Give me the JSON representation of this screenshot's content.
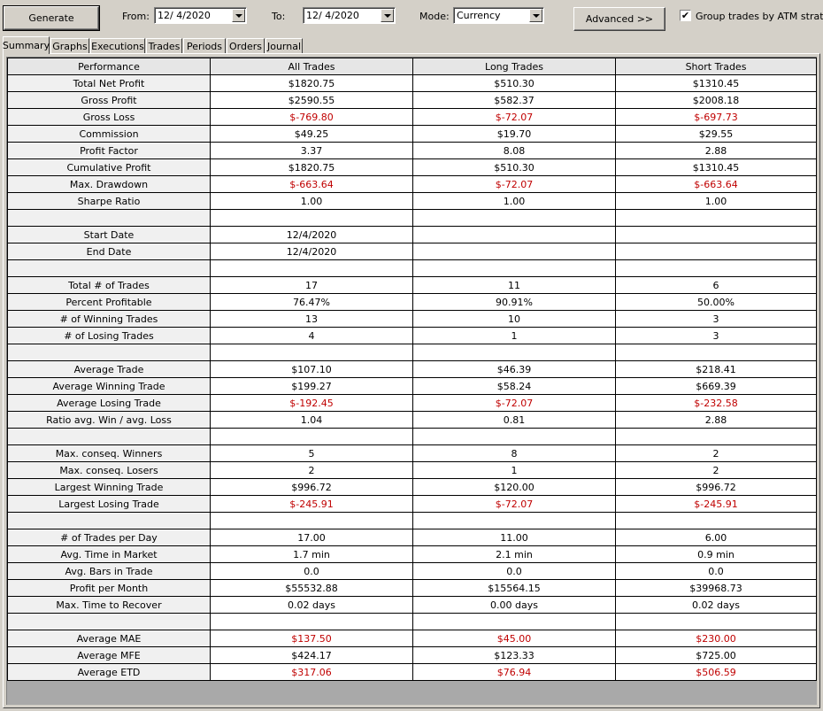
{
  "toolbar": {
    "generate_label": "Generate",
    "from_label": "From:",
    "from_value": "12/  4/2020",
    "to_label": "To:",
    "to_value": "12/  4/2020",
    "mode_label": "Mode:",
    "mode_value": "Currency",
    "advanced_label": "Advanced >>",
    "group_checked": true,
    "group_label": "Group trades by ATM strategy"
  },
  "tabs": [
    "Summary",
    "Graphs",
    "Executions",
    "Trades",
    "Periods",
    "Orders",
    "Journal"
  ],
  "active_tab": "Summary",
  "table": {
    "columns": [
      "Performance",
      "All Trades",
      "Long Trades",
      "Short Trades"
    ],
    "rows": [
      {
        "label": "Total Net Profit",
        "values": [
          "$1820.75",
          "$510.30",
          "$1310.45"
        ],
        "neg": [
          false,
          false,
          false
        ]
      },
      {
        "label": "Gross Profit",
        "values": [
          "$2590.55",
          "$582.37",
          "$2008.18"
        ],
        "neg": [
          false,
          false,
          false
        ]
      },
      {
        "label": "Gross Loss",
        "values": [
          "$-769.80",
          "$-72.07",
          "$-697.73"
        ],
        "neg": [
          true,
          true,
          true
        ]
      },
      {
        "label": "Commission",
        "values": [
          "$49.25",
          "$19.70",
          "$29.55"
        ],
        "neg": [
          false,
          false,
          false
        ]
      },
      {
        "label": "Profit Factor",
        "values": [
          "3.37",
          "8.08",
          "2.88"
        ],
        "neg": [
          false,
          false,
          false
        ]
      },
      {
        "label": "Cumulative Profit",
        "values": [
          "$1820.75",
          "$510.30",
          "$1310.45"
        ],
        "neg": [
          false,
          false,
          false
        ]
      },
      {
        "label": "Max. Drawdown",
        "values": [
          "$-663.64",
          "$-72.07",
          "$-663.64"
        ],
        "neg": [
          true,
          true,
          true
        ]
      },
      {
        "label": "Sharpe Ratio",
        "values": [
          "1.00",
          "1.00",
          "1.00"
        ],
        "neg": [
          false,
          false,
          false
        ]
      },
      {
        "label": "",
        "values": [
          "",
          "",
          ""
        ],
        "neg": [
          false,
          false,
          false
        ]
      },
      {
        "label": "Start Date",
        "values": [
          "12/4/2020",
          "",
          ""
        ],
        "neg": [
          false,
          false,
          false
        ]
      },
      {
        "label": "End Date",
        "values": [
          "12/4/2020",
          "",
          ""
        ],
        "neg": [
          false,
          false,
          false
        ]
      },
      {
        "label": "",
        "values": [
          "",
          "",
          ""
        ],
        "neg": [
          false,
          false,
          false
        ]
      },
      {
        "label": "Total # of Trades",
        "values": [
          "17",
          "11",
          "6"
        ],
        "neg": [
          false,
          false,
          false
        ]
      },
      {
        "label": "Percent Profitable",
        "values": [
          "76.47%",
          "90.91%",
          "50.00%"
        ],
        "neg": [
          false,
          false,
          false
        ]
      },
      {
        "label": "# of Winning Trades",
        "values": [
          "13",
          "10",
          "3"
        ],
        "neg": [
          false,
          false,
          false
        ]
      },
      {
        "label": "# of Losing Trades",
        "values": [
          "4",
          "1",
          "3"
        ],
        "neg": [
          false,
          false,
          false
        ]
      },
      {
        "label": "",
        "values": [
          "",
          "",
          ""
        ],
        "neg": [
          false,
          false,
          false
        ]
      },
      {
        "label": "Average Trade",
        "values": [
          "$107.10",
          "$46.39",
          "$218.41"
        ],
        "neg": [
          false,
          false,
          false
        ]
      },
      {
        "label": "Average Winning Trade",
        "values": [
          "$199.27",
          "$58.24",
          "$669.39"
        ],
        "neg": [
          false,
          false,
          false
        ]
      },
      {
        "label": "Average Losing Trade",
        "values": [
          "$-192.45",
          "$-72.07",
          "$-232.58"
        ],
        "neg": [
          true,
          true,
          true
        ]
      },
      {
        "label": "Ratio avg. Win / avg. Loss",
        "values": [
          "1.04",
          "0.81",
          "2.88"
        ],
        "neg": [
          false,
          false,
          false
        ]
      },
      {
        "label": "",
        "values": [
          "",
          "",
          ""
        ],
        "neg": [
          false,
          false,
          false
        ]
      },
      {
        "label": "Max. conseq. Winners",
        "values": [
          "5",
          "8",
          "2"
        ],
        "neg": [
          false,
          false,
          false
        ]
      },
      {
        "label": "Max. conseq. Losers",
        "values": [
          "2",
          "1",
          "2"
        ],
        "neg": [
          false,
          false,
          false
        ]
      },
      {
        "label": "Largest Winning Trade",
        "values": [
          "$996.72",
          "$120.00",
          "$996.72"
        ],
        "neg": [
          false,
          false,
          false
        ]
      },
      {
        "label": "Largest Losing Trade",
        "values": [
          "$-245.91",
          "$-72.07",
          "$-245.91"
        ],
        "neg": [
          true,
          true,
          true
        ]
      },
      {
        "label": "",
        "values": [
          "",
          "",
          ""
        ],
        "neg": [
          false,
          false,
          false
        ]
      },
      {
        "label": "# of Trades per Day",
        "values": [
          "17.00",
          "11.00",
          "6.00"
        ],
        "neg": [
          false,
          false,
          false
        ]
      },
      {
        "label": "Avg. Time in Market",
        "values": [
          "1.7 min",
          "2.1 min",
          "0.9 min"
        ],
        "neg": [
          false,
          false,
          false
        ]
      },
      {
        "label": "Avg. Bars in Trade",
        "values": [
          "0.0",
          "0.0",
          "0.0"
        ],
        "neg": [
          false,
          false,
          false
        ]
      },
      {
        "label": "Profit per Month",
        "values": [
          "$55532.88",
          "$15564.15",
          "$39968.73"
        ],
        "neg": [
          false,
          false,
          false
        ]
      },
      {
        "label": "Max. Time to Recover",
        "values": [
          "0.02 days",
          "0.00 days",
          "0.02 days"
        ],
        "neg": [
          false,
          false,
          false
        ]
      },
      {
        "label": "",
        "values": [
          "",
          "",
          ""
        ],
        "neg": [
          false,
          false,
          false
        ]
      },
      {
        "label": "Average MAE",
        "values": [
          "$137.50",
          "$45.00",
          "$230.00"
        ],
        "neg": [
          true,
          true,
          true
        ]
      },
      {
        "label": "Average MFE",
        "values": [
          "$424.17",
          "$123.33",
          "$725.00"
        ],
        "neg": [
          false,
          false,
          false
        ]
      },
      {
        "label": "Average ETD",
        "values": [
          "$317.06",
          "$76.94",
          "$506.59"
        ],
        "neg": [
          true,
          true,
          true
        ]
      }
    ]
  }
}
